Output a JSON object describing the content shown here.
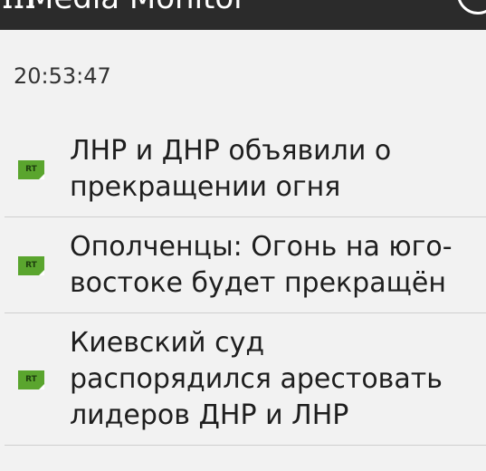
{
  "app_bar": {
    "title_fragment": "Media Monitor",
    "title_prefix_fragment": "ɪɪɪ"
  },
  "timestamp": "20:53:47",
  "news": [
    {
      "source_icon": "RT",
      "title": "ЛНР и ДНР объявили о прекращении огня"
    },
    {
      "source_icon": "RT",
      "title": "Ополченцы: Огонь на юго-востоке будет прекращён"
    },
    {
      "source_icon": "RT",
      "title": "Киевский суд распорядился арестовать лидеров ДНР и ЛНР"
    }
  ],
  "colors": {
    "app_bar": "#2b2b2b",
    "background": "#f2f2f2",
    "rt_green": "#5aa52e"
  },
  "icons": {
    "source": "rt-logo-icon",
    "action": "circle-action-icon"
  }
}
